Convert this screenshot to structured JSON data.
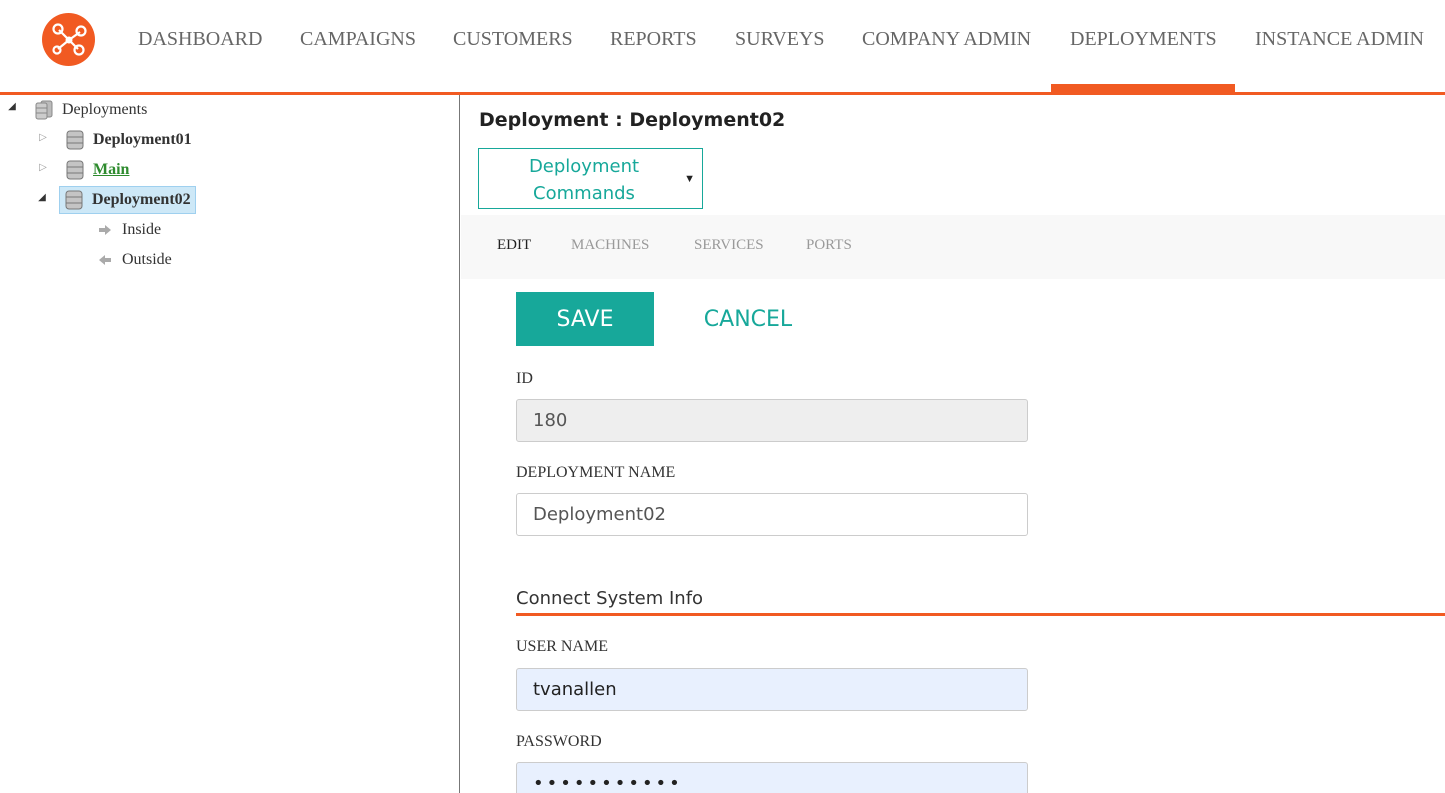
{
  "colors": {
    "brand": "#f15a22",
    "accent": "#17a89a",
    "selected_bg": "#cde8f7",
    "link_green": "#2e8b2e"
  },
  "nav": {
    "logo_icon": "network-nodes-icon",
    "items": [
      {
        "label": "DASHBOARD"
      },
      {
        "label": "CAMPAIGNS"
      },
      {
        "label": "CUSTOMERS"
      },
      {
        "label": "REPORTS"
      },
      {
        "label": "SURVEYS"
      },
      {
        "label": "COMPANY ADMIN"
      },
      {
        "label": "DEPLOYMENTS",
        "active": true
      },
      {
        "label": "INSTANCE ADMIN"
      }
    ]
  },
  "tree": {
    "root": {
      "label": "Deployments",
      "icon": "database-stack-icon",
      "expanded": true
    },
    "children": [
      {
        "label": "Deployment01",
        "icon": "database-icon",
        "expanded": false
      },
      {
        "label": "Main",
        "icon": "database-icon",
        "expanded": false
      },
      {
        "label": "Deployment02",
        "icon": "database-icon",
        "expanded": true,
        "selected": true,
        "children": [
          {
            "label": "Inside",
            "icon": "arrow-right-icon"
          },
          {
            "label": "Outside",
            "icon": "arrow-left-icon"
          }
        ]
      }
    ]
  },
  "main": {
    "title": "Deployment : Deployment02",
    "commands_label": "Deployment Commands",
    "tabs": [
      {
        "label": "EDIT",
        "active": true
      },
      {
        "label": "MACHINES"
      },
      {
        "label": "SERVICES"
      },
      {
        "label": "PORTS"
      }
    ],
    "save_label": "SAVE",
    "cancel_label": "CANCEL",
    "fields": {
      "id": {
        "label": "ID",
        "value": "180"
      },
      "deployment_name": {
        "label": "DEPLOYMENT NAME",
        "value": "Deployment02"
      },
      "user_name": {
        "label": "USER NAME",
        "value": "tvanallen"
      },
      "password": {
        "label": "PASSWORD",
        "value": "secretpass1"
      }
    },
    "section_title": "Connect System Info"
  }
}
